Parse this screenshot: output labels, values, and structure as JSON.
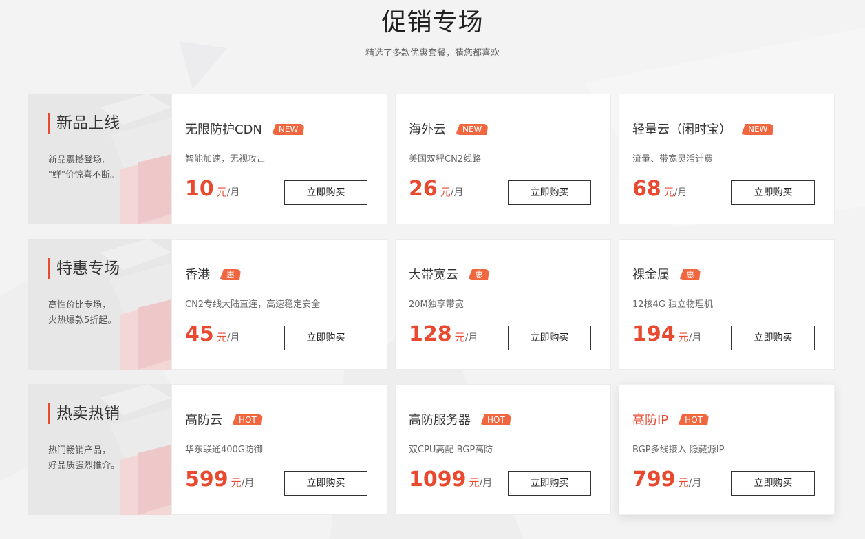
{
  "header": {
    "title": "促销专场",
    "subtitle": "精选了多款优惠套餐，猜您都喜欢"
  },
  "colors": {
    "accent": "#e8492f",
    "badge": "#f0663f",
    "background": "#f3f3f4"
  },
  "buy_label": "立即购买",
  "price_unit": "元",
  "price_per": "/月",
  "rows": [
    {
      "title": "新品上线",
      "desc_line1": "新品震撼登场,",
      "desc_line2": "\"鲜\"价惊喜不断。",
      "cards": [
        {
          "name": "无限防护CDN",
          "badge": "NEW",
          "desc": "智能加速，无视攻击",
          "price": "10"
        },
        {
          "name": "海外云",
          "badge": "NEW",
          "desc": "美国双程CN2线路",
          "price": "26"
        },
        {
          "name": "轻量云（闲时宝）",
          "badge": "NEW",
          "desc": "流量、带宽灵活计费",
          "price": "68"
        }
      ]
    },
    {
      "title": "特惠专场",
      "desc_line1": "高性价比专场，",
      "desc_line2": "火热爆款5折起。",
      "cards": [
        {
          "name": "香港",
          "badge": "惠",
          "desc": "CN2专线大陆直连，高速稳定安全",
          "price": "45"
        },
        {
          "name": "大带宽云",
          "badge": "惠",
          "desc": "20M独享带宽",
          "price": "128"
        },
        {
          "name": "裸金属",
          "badge": "惠",
          "desc": "12核4G 独立物理机",
          "price": "194"
        }
      ]
    },
    {
      "title": "热卖热销",
      "desc_line1": "热门畅销产品，",
      "desc_line2": "好品质强烈推介。",
      "cards": [
        {
          "name": "高防云",
          "badge": "HOT",
          "desc": "华东联通400G防御",
          "price": "599"
        },
        {
          "name": "高防服务器",
          "badge": "HOT",
          "desc": "双CPU高配 BGP高防",
          "price": "1099"
        },
        {
          "name": "高防IP",
          "badge": "HOT",
          "desc": "BGP多线接入 隐藏源IP",
          "price": "799"
        }
      ]
    }
  ]
}
